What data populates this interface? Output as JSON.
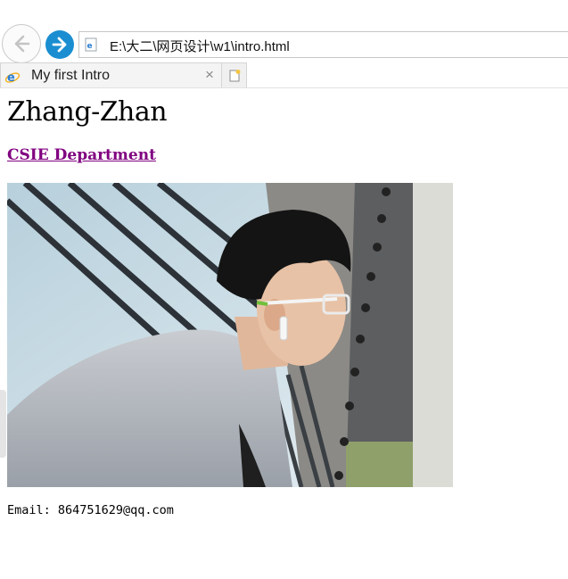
{
  "browser": {
    "address": "E:\\大二\\网页设计\\w1\\intro.html",
    "tab_title": "My first Intro",
    "tab_close": "×",
    "icons": {
      "back": "back-arrow-icon",
      "forward": "forward-arrow-icon",
      "page": "ie-page-icon",
      "new_tab": "new-tab-icon"
    },
    "colors": {
      "forward_button": "#1a8ed1"
    }
  },
  "page": {
    "heading": "Zhang-Zhan",
    "department_link": "CSIE Department",
    "email": "Email: 864751629@qq.com",
    "colors": {
      "link_visited": "#800080"
    }
  }
}
